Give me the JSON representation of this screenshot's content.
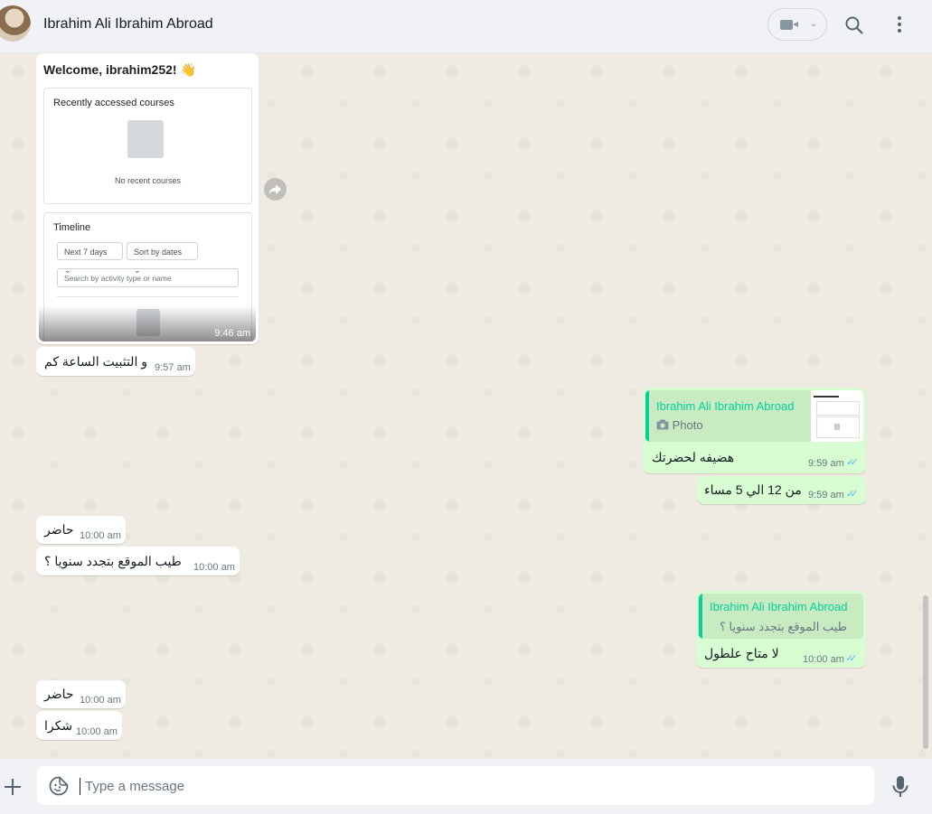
{
  "header": {
    "contact_name": "Ibrahim Ali Ibrahim Abroad"
  },
  "image_message": {
    "time": "9:46 am",
    "screenshot": {
      "welcome": "Welcome, ibrahim252! 👋",
      "recent_title": "Recently accessed courses",
      "no_courses": "No recent courses",
      "timeline_title": "Timeline",
      "filter_days": "Next 7 days",
      "filter_sort": "Sort by dates",
      "search_placeholder": "Search by activity type or name"
    }
  },
  "messages": [
    {
      "text": "و التثبيت الساعة كم",
      "time": "9:57 am"
    },
    {
      "quote_name": "Ibrahim Ali Ibrahim Abroad",
      "quote_body": "Photo",
      "text": "هضيفه لحضرتك",
      "time": "9:59 am"
    },
    {
      "text": "من 12 الي 5 مساء",
      "time": "9:59 am"
    },
    {
      "text": "حاضر",
      "time": "10:00 am"
    },
    {
      "text": "طيب الموقع بتجدد سنويا ؟",
      "time": "10:00 am"
    },
    {
      "quote_name": "Ibrahim Ali Ibrahim Abroad",
      "quote_body": "طيب الموقع بتجدد سنويا ؟",
      "text": "لا متاح علطول",
      "time": "10:00 am"
    },
    {
      "text": "حاضر",
      "time": "10:00 am"
    },
    {
      "text": "شكرا",
      "time": "10:00 am"
    }
  ],
  "composer": {
    "placeholder": "Type a message"
  },
  "icons": {
    "video": "video-call-icon",
    "search": "search-icon",
    "menu": "menu-icon",
    "forward": "forward-icon",
    "plus": "plus-icon",
    "sticker": "sticker-icon",
    "mic": "mic-icon",
    "camera": "camera-icon",
    "read_receipt": "double-check-icon"
  },
  "colors": {
    "incoming": "#ffffff",
    "outgoing": "#d9fdd3",
    "accent": "#06cf9c",
    "read_tick": "#53bdeb"
  }
}
